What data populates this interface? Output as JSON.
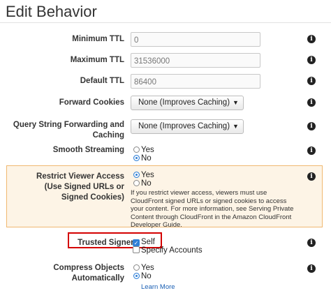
{
  "page": {
    "title": "Edit Behavior"
  },
  "fields": {
    "min_ttl": {
      "label": "Minimum TTL",
      "value": "0"
    },
    "max_ttl": {
      "label": "Maximum TTL",
      "value": "31536000"
    },
    "default_ttl": {
      "label": "Default TTL",
      "value": "86400"
    },
    "forward_cookies": {
      "label": "Forward Cookies",
      "selected": "None (Improves Caching)"
    },
    "query_string": {
      "label_line1": "Query String Forwarding and",
      "label_line2": "Caching",
      "selected": "None (Improves Caching)"
    },
    "smooth_streaming": {
      "label": "Smooth Streaming",
      "options": [
        "Yes",
        "No"
      ],
      "selected": "No"
    },
    "restrict_viewer": {
      "label_line1": "Restrict Viewer Access",
      "label_line2": "(Use Signed URLs or",
      "label_line3": "Signed Cookies)",
      "options": [
        "Yes",
        "No"
      ],
      "selected": "Yes",
      "help": "If you restrict viewer access, viewers must use CloudFront signed URLs or signed cookies to access your content. For more information, see Serving Private Content through CloudFront in the Amazon CloudFront Developer Guide."
    },
    "trusted_signers": {
      "label": "Trusted Signers",
      "options": [
        "Self",
        "Specify Accounts"
      ],
      "checked": "Self"
    },
    "compress": {
      "label": "Compress Objects Automatically",
      "options": [
        "Yes",
        "No"
      ],
      "selected": "No",
      "learn_more": "Learn More"
    }
  },
  "icons": {
    "info": "info-icon",
    "dropdown": "chevron-down-icon"
  },
  "colors": {
    "accent": "#2f7fd6",
    "warning_bg": "#fdf4e6",
    "warning_border": "#f0b870",
    "highlight": "#d40000",
    "link": "#1a5fb4"
  }
}
